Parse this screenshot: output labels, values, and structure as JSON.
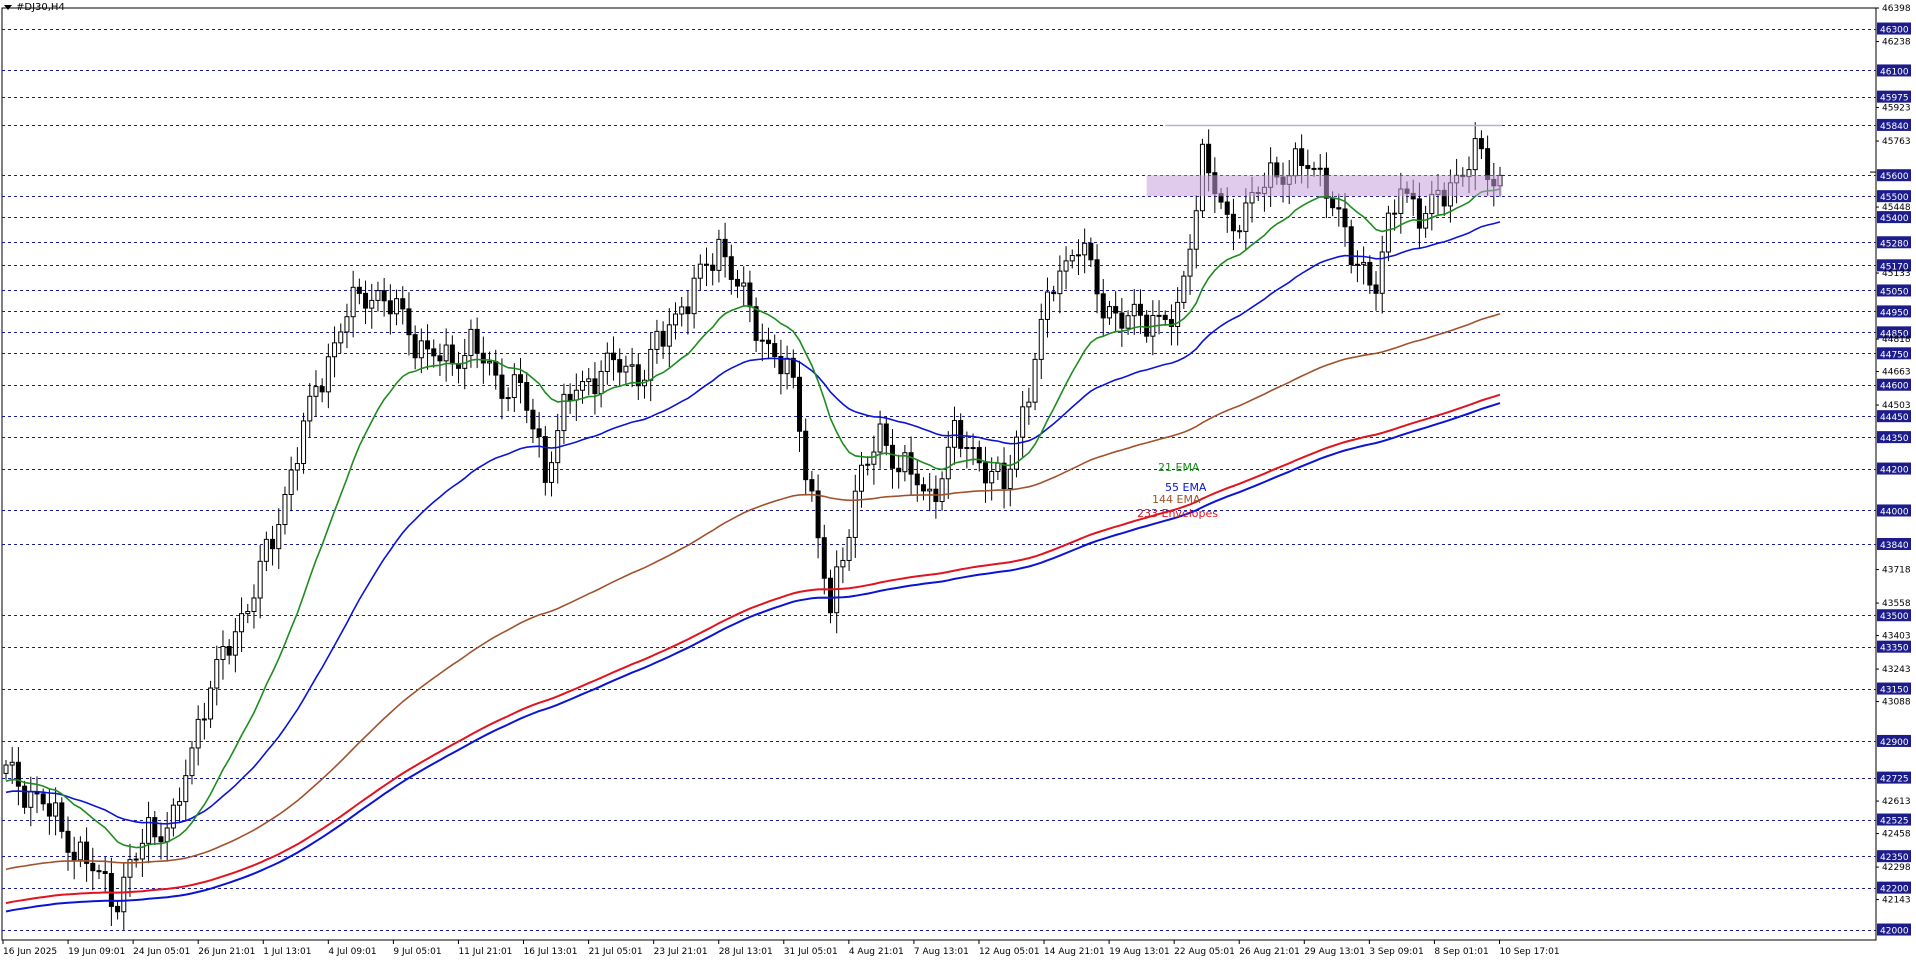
{
  "window": {
    "symbol_timeframe": "#DJ30,H4"
  },
  "colors": {
    "background": "#ffffff",
    "candle": "#000000",
    "grid": "#1c1c8c",
    "ema21": "#1e8c1e",
    "ema55": "#0a14d2",
    "ema144": "#a0522d",
    "envelope_upper": "#e0141e",
    "envelope_lower": "#0a14d2",
    "zone": "#c8a0dc",
    "resistance_line": "#b4b4d2",
    "price_marker": "#1c1c8c"
  },
  "chart_data": {
    "type": "candlestick",
    "title": "#DJ30,H4",
    "ylim": [
      41950,
      46398
    ],
    "y_axis_labels": [
      "46398",
      "46300",
      "46238",
      "46100",
      "45975",
      "45923",
      "45840",
      "45763",
      "45600",
      "45500",
      "45448",
      "45400",
      "45280",
      "45170",
      "45133",
      "45050",
      "44950",
      "44850",
      "44818",
      "44750",
      "44663",
      "44600",
      "44503",
      "44450",
      "44350",
      "44200",
      "44000",
      "43840",
      "43718",
      "43558",
      "43500",
      "43403",
      "43350",
      "43243",
      "43150",
      "43088",
      "42900",
      "42725",
      "42613",
      "42525",
      "42458",
      "42350",
      "42298",
      "42200",
      "42143",
      "42000"
    ],
    "horizontal_levels": [
      46300,
      46100,
      45975,
      45840,
      45600,
      45500,
      45400,
      45280,
      45170,
      45050,
      44950,
      44850,
      44750,
      44600,
      44450,
      44350,
      44200,
      44000,
      43840,
      43500,
      43350,
      43150,
      42900,
      42725,
      42525,
      42350,
      42200,
      42000
    ],
    "x_tick_labels": [
      "16 Jun 2025",
      "19 Jun 09:01",
      "24 Jun 05:01",
      "26 Jun 21:01",
      "1 Jul 13:01",
      "4 Jul 09:01",
      "9 Jul 05:01",
      "11 Jul 21:01",
      "16 Jul 13:01",
      "21 Jul 05:01",
      "23 Jul 21:01",
      "28 Jul 13:01",
      "31 Jul 05:01",
      "4 Aug 21:01",
      "7 Aug 13:01",
      "12 Aug 05:01",
      "14 Aug 21:01",
      "19 Aug 13:01",
      "22 Aug 05:01",
      "26 Aug 21:01",
      "29 Aug 13:01",
      "3 Sep 09:01",
      "8 Sep 01:01",
      "10 Sep 17:01"
    ],
    "price_path_keypoints": [
      [
        0,
        42750
      ],
      [
        6,
        42600
      ],
      [
        12,
        42350
      ],
      [
        18,
        42150
      ],
      [
        23,
        42480
      ],
      [
        27,
        42500
      ],
      [
        32,
        43100
      ],
      [
        37,
        43420
      ],
      [
        43,
        43850
      ],
      [
        47,
        44300
      ],
      [
        51,
        44650
      ],
      [
        55,
        44950
      ],
      [
        59,
        45050
      ],
      [
        63,
        44950
      ],
      [
        67,
        44780
      ],
      [
        71,
        44700
      ],
      [
        75,
        44800
      ],
      [
        79,
        44620
      ],
      [
        83,
        44580
      ],
      [
        87,
        44200
      ],
      [
        91,
        44550
      ],
      [
        95,
        44650
      ],
      [
        99,
        44700
      ],
      [
        103,
        44650
      ],
      [
        107,
        44900
      ],
      [
        111,
        45050
      ],
      [
        115,
        45280
      ],
      [
        119,
        45000
      ],
      [
        123,
        44780
      ],
      [
        127,
        44600
      ],
      [
        130,
        44050
      ],
      [
        133,
        43500
      ],
      [
        137,
        44100
      ],
      [
        141,
        44350
      ],
      [
        145,
        44200
      ],
      [
        149,
        44050
      ],
      [
        153,
        44350
      ],
      [
        157,
        44250
      ],
      [
        161,
        44100
      ],
      [
        165,
        44600
      ],
      [
        169,
        45100
      ],
      [
        173,
        45280
      ],
      [
        177,
        44980
      ],
      [
        181,
        44900
      ],
      [
        185,
        44930
      ],
      [
        189,
        44900
      ],
      [
        193,
        45700
      ],
      [
        197,
        45350
      ],
      [
        201,
        45480
      ],
      [
        205,
        45620
      ],
      [
        209,
        45650
      ],
      [
        213,
        45580
      ],
      [
        217,
        45200
      ],
      [
        221,
        45100
      ],
      [
        225,
        45550
      ],
      [
        229,
        45400
      ],
      [
        233,
        45560
      ],
      [
        237,
        45700
      ],
      [
        240,
        45590
      ]
    ],
    "series": [
      {
        "name": "21 EMA",
        "label": "21 EMA",
        "period": 21
      },
      {
        "name": "55 EMA",
        "label": "55 EMA",
        "period": 55
      },
      {
        "name": "144 EMA",
        "label": "144 EMA",
        "period": 144
      },
      {
        "name": "233 Envelopes",
        "label": "233 Envelopes",
        "period": 233
      }
    ],
    "resistance_level": 45840,
    "zone": {
      "low": 45500,
      "high": 45600
    },
    "current_price": 45615,
    "grid": true
  }
}
